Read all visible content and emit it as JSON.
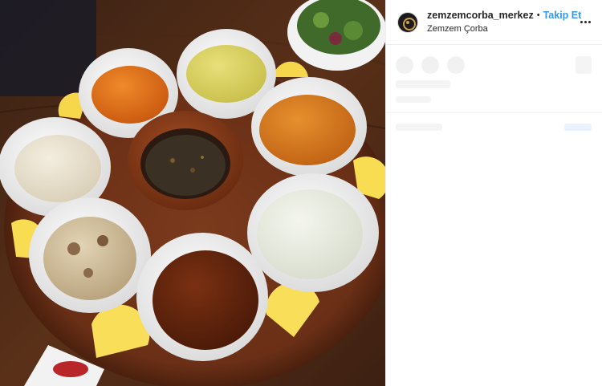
{
  "post": {
    "username": "zemzemcorba_merkez",
    "separator": "•",
    "follow_label": "Takip Et",
    "location": "Zemzem Çorba"
  },
  "icons": {
    "more": "more-options-icon",
    "avatar": "profile-avatar"
  },
  "colors": {
    "follow_blue": "#3897f0",
    "text": "#262626",
    "border": "#efefef"
  }
}
